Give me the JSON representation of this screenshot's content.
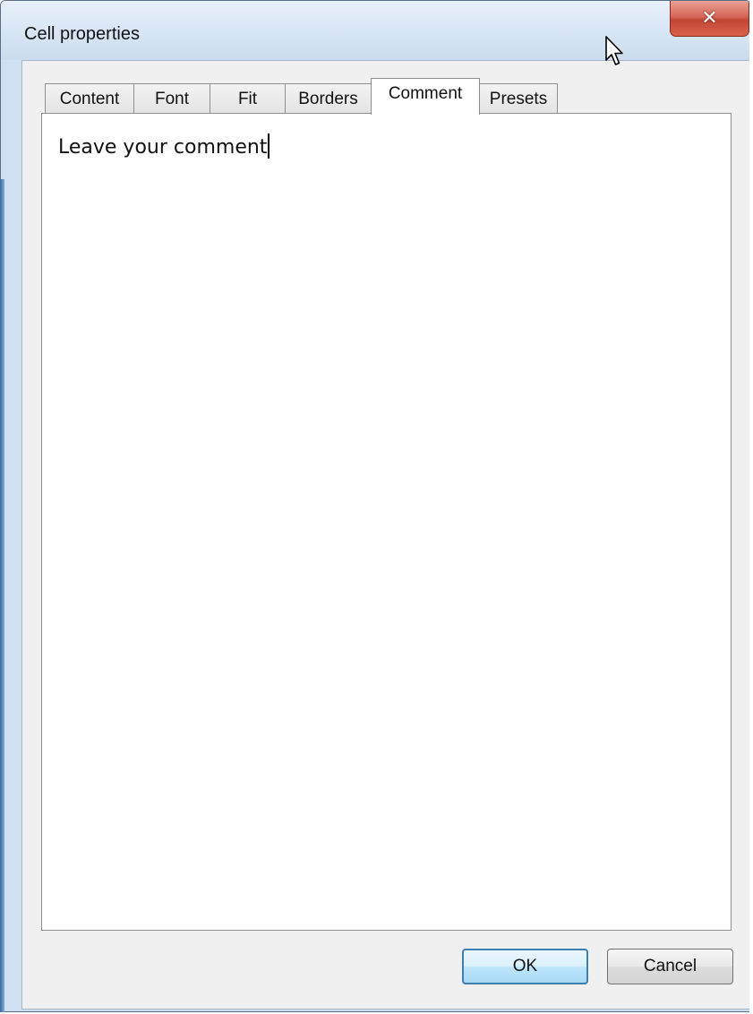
{
  "window": {
    "title": "Cell properties",
    "close_icon": "close-icon"
  },
  "tabs": [
    {
      "label": "Content",
      "active": false
    },
    {
      "label": "Font",
      "active": false
    },
    {
      "label": "Fit",
      "active": false
    },
    {
      "label": "Borders",
      "active": false
    },
    {
      "label": "Comment",
      "active": true
    },
    {
      "label": "Presets",
      "active": false
    }
  ],
  "comment": {
    "value": "Leave your comment"
  },
  "buttons": {
    "ok_label": "OK",
    "cancel_label": "Cancel"
  },
  "colors": {
    "titlebar": "#d8e6f5",
    "close_button": "#c24534",
    "default_button_border": "#3c7fb1"
  }
}
